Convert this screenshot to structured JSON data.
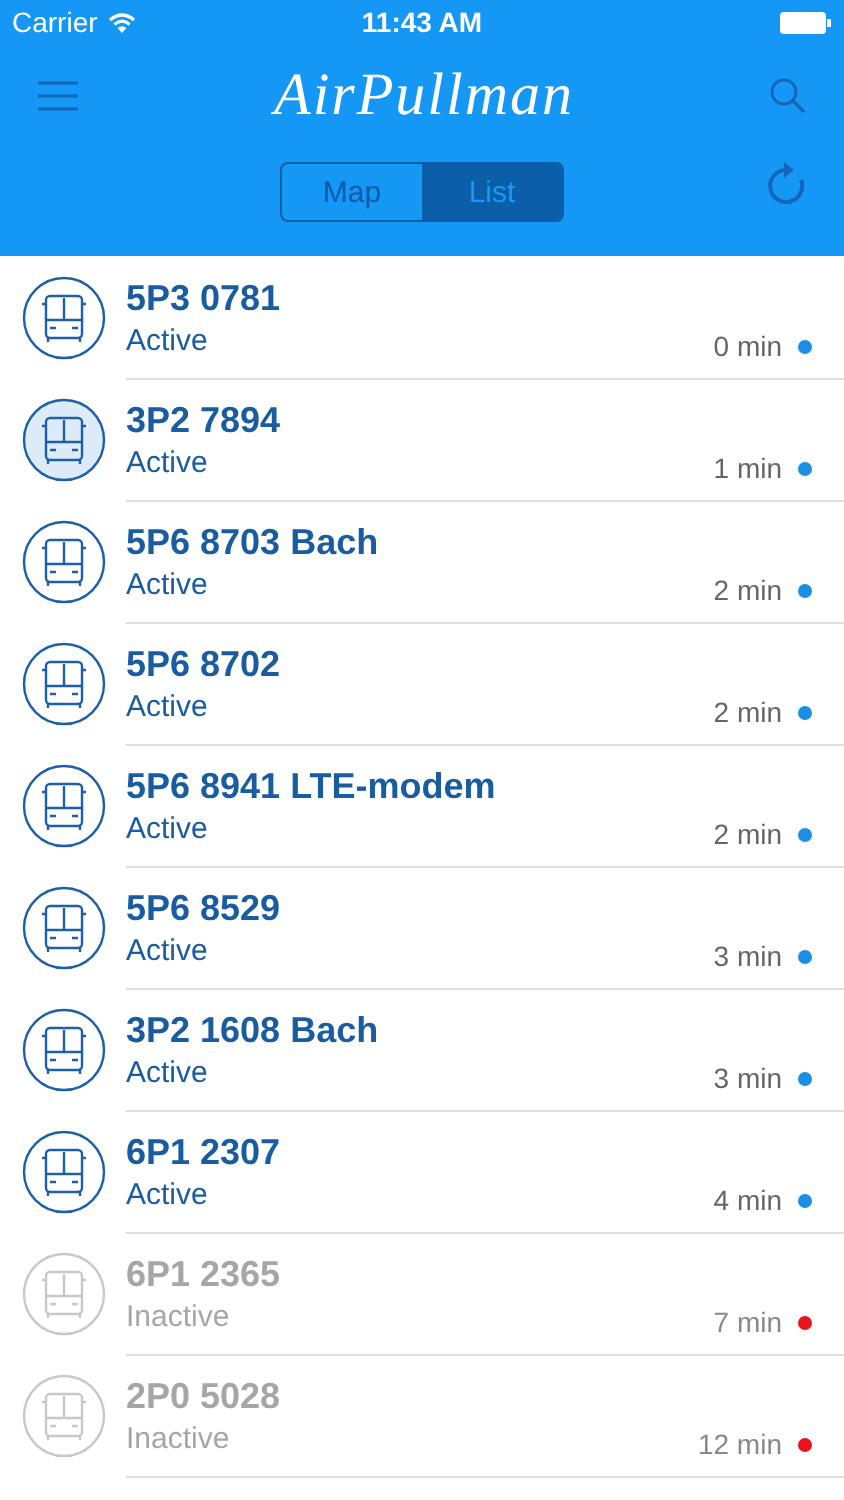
{
  "status_bar": {
    "carrier": "Carrier",
    "time": "11:43 AM"
  },
  "nav": {
    "logo": "AirPullman"
  },
  "segments": [
    {
      "label": "Map",
      "selected": false
    },
    {
      "label": "List",
      "selected": true
    }
  ],
  "vehicles": [
    {
      "name": "5P3 0781",
      "status": "Active",
      "age": "0 min",
      "active": true,
      "selected": false,
      "color": "#1a8fe3"
    },
    {
      "name": "3P2 7894",
      "status": "Active",
      "age": "1 min",
      "active": true,
      "selected": true,
      "color": "#1a8fe3"
    },
    {
      "name": "5P6 8703 Bach",
      "status": "Active",
      "age": "2 min",
      "active": true,
      "selected": false,
      "color": "#1a8fe3"
    },
    {
      "name": "5P6 8702",
      "status": "Active",
      "age": "2 min",
      "active": true,
      "selected": false,
      "color": "#1a8fe3"
    },
    {
      "name": "5P6 8941 LTE-modem",
      "status": "Active",
      "age": "2 min",
      "active": true,
      "selected": false,
      "color": "#1a8fe3"
    },
    {
      "name": "5P6 8529",
      "status": "Active",
      "age": "3 min",
      "active": true,
      "selected": false,
      "color": "#1a8fe3"
    },
    {
      "name": "3P2 1608 Bach",
      "status": "Active",
      "age": "3 min",
      "active": true,
      "selected": false,
      "color": "#1a8fe3"
    },
    {
      "name": "6P1 2307",
      "status": "Active",
      "age": "4 min",
      "active": true,
      "selected": false,
      "color": "#1a8fe3"
    },
    {
      "name": "6P1 2365",
      "status": "Inactive",
      "age": "7 min",
      "active": false,
      "selected": false,
      "color": "#e8141e"
    },
    {
      "name": "2P0 5028",
      "status": "Inactive",
      "age": "12 min",
      "active": false,
      "selected": false,
      "color": "#e8141e"
    }
  ]
}
